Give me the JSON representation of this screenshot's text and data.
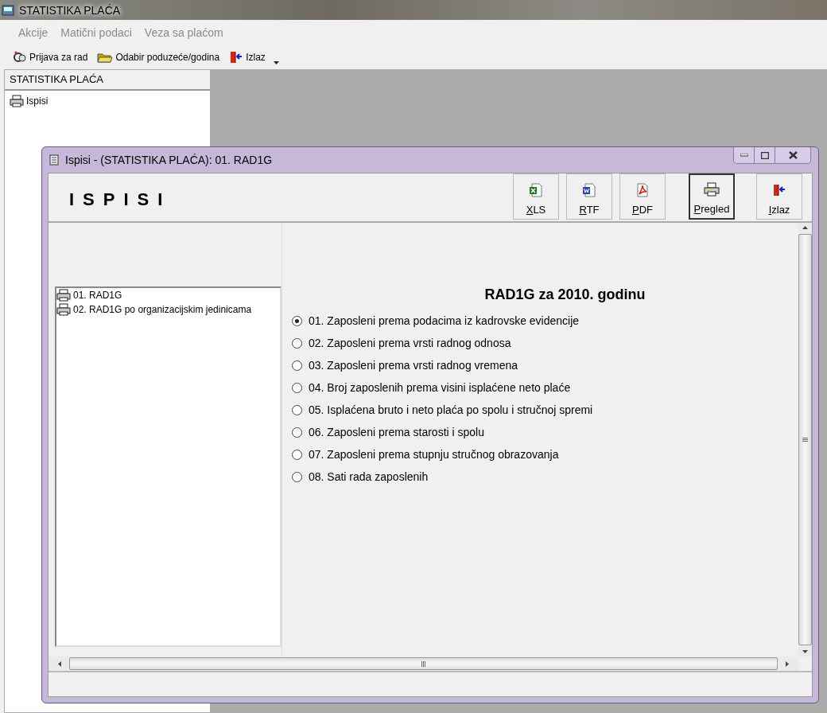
{
  "window": {
    "title": "STATISTIKA PLAĆA"
  },
  "menu": [
    "Akcije",
    "Matični podaci",
    "Veza sa plaćom"
  ],
  "toolbar": [
    {
      "label": "Prijava za rad",
      "kind": "login"
    },
    {
      "label": "Odabir poduzeće/godina",
      "kind": "folder"
    },
    {
      "label": "Izlaz",
      "kind": "exit"
    }
  ],
  "sidebar": {
    "title": "STATISTIKA PLAĆA",
    "items": [
      {
        "label": "Ispisi"
      }
    ]
  },
  "child_window": {
    "title": "Ispisi - (STATISTIKA PLAĆA):  01. RAD1G",
    "heading": "ISPISI",
    "buttons": [
      {
        "label": "XLS",
        "kind": "xls",
        "focused": false
      },
      {
        "label": "RTF",
        "kind": "rtf",
        "focused": false
      },
      {
        "label": "PDF",
        "kind": "pdf",
        "focused": false
      },
      {
        "label": "Pregled",
        "kind": "print",
        "focused": true
      },
      {
        "label": "Izlaz",
        "kind": "exit",
        "focused": false
      }
    ],
    "reports": [
      "01. RAD1G",
      "02. RAD1G po organizacijskim jedinicama"
    ],
    "report_title": "RAD1G za 2010. godinu",
    "options": [
      {
        "label": "01. Zaposleni prema podacima iz kadrovske evidencije",
        "selected": true
      },
      {
        "label": "02. Zaposleni prema vrsti radnog odnosa",
        "selected": false
      },
      {
        "label": "03. Zaposleni prema vrsti radnog vremena",
        "selected": false
      },
      {
        "label": "04. Broj zaposlenih prema visini isplaćene neto plaće",
        "selected": false
      },
      {
        "label": "05. Isplaćena bruto i neto plaća po spolu i stručnoj spremi",
        "selected": false
      },
      {
        "label": "06. Zaposleni prema starosti i spolu",
        "selected": false
      },
      {
        "label": "07. Zaposleni prema stupnju stručnog obrazovanja",
        "selected": false
      },
      {
        "label": "08. Sati rada zaposlenih",
        "selected": false
      }
    ]
  }
}
